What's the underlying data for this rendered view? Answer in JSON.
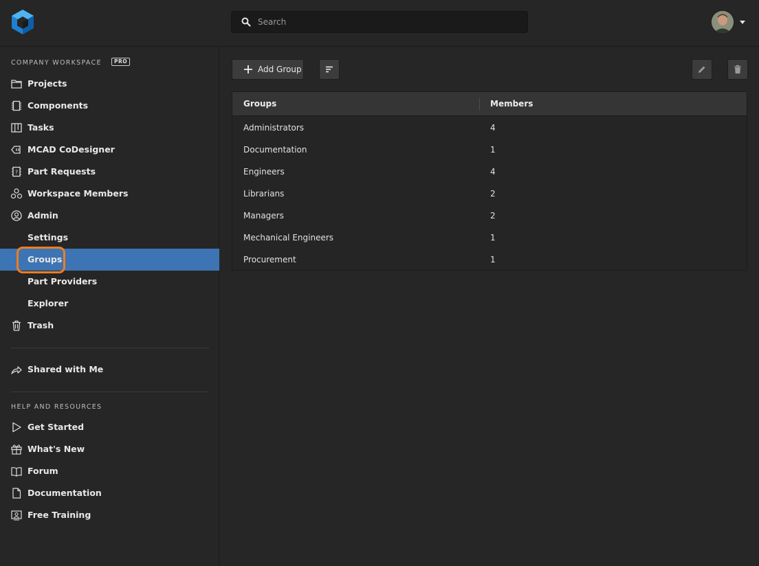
{
  "search": {
    "placeholder": "Search"
  },
  "sidebar": {
    "workspace_title": "COMPANY WORKSPACE",
    "badge": "PRO",
    "items": [
      {
        "label": "Projects",
        "icon": "folder-icon"
      },
      {
        "label": "Components",
        "icon": "chip-icon"
      },
      {
        "label": "Tasks",
        "icon": "kanban-icon"
      },
      {
        "label": "MCAD CoDesigner",
        "icon": "mcad-icon"
      },
      {
        "label": "Part Requests",
        "icon": "part-request-icon"
      },
      {
        "label": "Workspace Members",
        "icon": "members-icon"
      },
      {
        "label": "Admin",
        "icon": "admin-icon"
      }
    ],
    "admin_sub": [
      {
        "label": "Settings"
      },
      {
        "label": "Groups",
        "active": true
      },
      {
        "label": "Part Providers"
      },
      {
        "label": "Explorer"
      }
    ],
    "trash": "Trash",
    "shared": "Shared with Me",
    "help_title": "HELP AND RESOURCES",
    "help_items": [
      {
        "label": "Get Started",
        "icon": "play-icon"
      },
      {
        "label": "What's New",
        "icon": "gift-icon"
      },
      {
        "label": "Forum",
        "icon": "book-icon"
      },
      {
        "label": "Documentation",
        "icon": "document-icon"
      },
      {
        "label": "Free Training",
        "icon": "training-icon"
      }
    ]
  },
  "toolbar": {
    "add_label": "Add Group"
  },
  "table": {
    "headers": [
      "Groups",
      "Members"
    ],
    "rows": [
      [
        "Administrators",
        "4"
      ],
      [
        "Documentation",
        "1"
      ],
      [
        "Engineers",
        "4"
      ],
      [
        "Librarians",
        "2"
      ],
      [
        "Managers",
        "2"
      ],
      [
        "Mechanical Engineers",
        "1"
      ],
      [
        "Procurement",
        "1"
      ]
    ]
  },
  "colors": {
    "active": "#3d74b3",
    "highlight": "#f07d22",
    "logo": "#2a8fd8"
  }
}
